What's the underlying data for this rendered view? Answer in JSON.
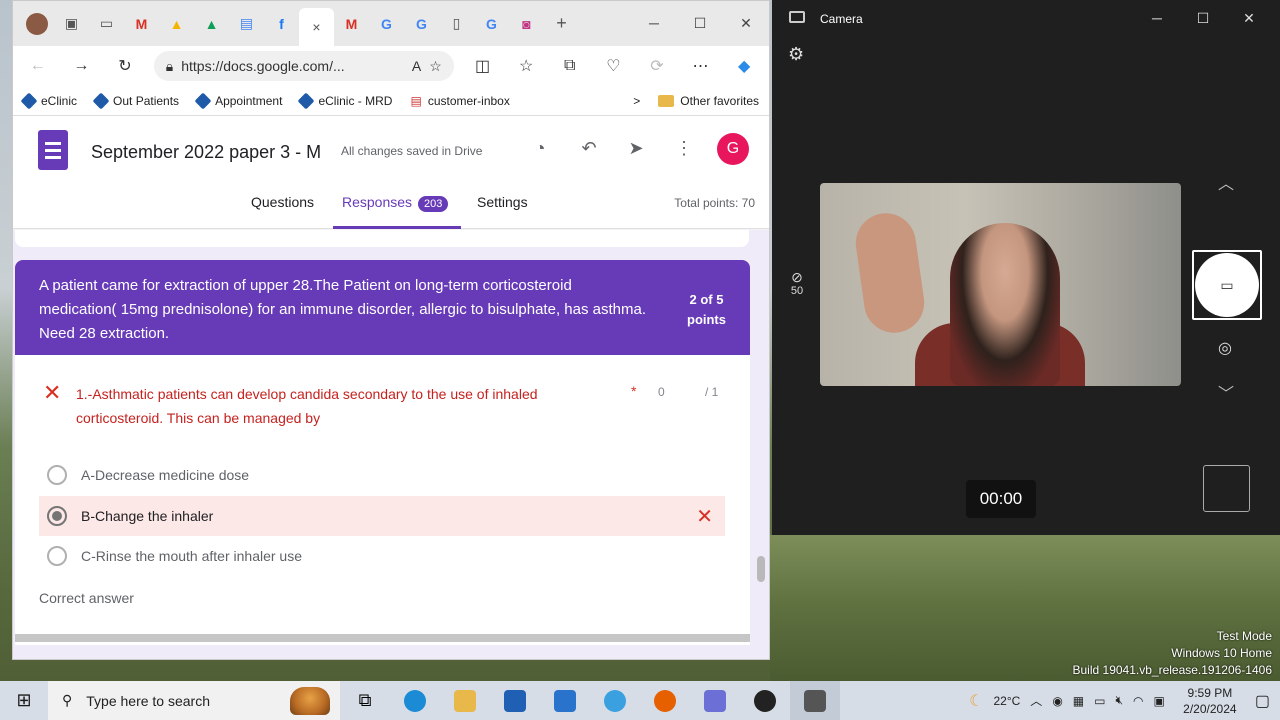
{
  "browser": {
    "tabs_active_close": "×",
    "new_tab": "+",
    "url": "https://docs.google.com/...",
    "favorites": [
      "eClinic",
      "Out Patients",
      "Appointment",
      "eClinic - MRD",
      "customer-inbox"
    ],
    "favorites_more": ">",
    "other_favorites": "Other favorites"
  },
  "form": {
    "title": "September 2022 paper 3 - M",
    "saved_status": "All changes saved in Drive",
    "avatar_letter": "G",
    "tabs": {
      "questions": "Questions",
      "responses": "Responses",
      "responses_count": "203",
      "settings": "Settings"
    },
    "total_points": "Total points: 70",
    "question": {
      "text": "A patient came for extraction of upper 28.The Patient on long-term corticosteroid medication( 15mg prednisolone)  for an immune disorder, allergic to bisulphate, has asthma. Need 28 extraction.",
      "points_line1": "2 of 5",
      "points_line2": "points",
      "sub_question": "1.-Asthmatic patients can develop candida secondary to the use of inhaled corticosteroid. This can be managed by",
      "required_mark": "*",
      "score": "0",
      "score_total": "/ 1",
      "options": [
        "A-Decrease medicine dose",
        "B-Change the inhaler",
        "C-Rinse the mouth after inhaler use"
      ],
      "correct_answer_label": "Correct answer"
    }
  },
  "camera": {
    "title": "Camera",
    "zoom_level": "50",
    "timer": "00:00"
  },
  "desktop": {
    "watermark": [
      "Test Mode",
      "Windows 10 Home",
      "Build 19041.vb_release.191206-1406"
    ]
  },
  "taskbar": {
    "search_placeholder": "Type here to search",
    "weather": "22°C",
    "time": "9:59 PM",
    "date": "2/20/2024"
  }
}
